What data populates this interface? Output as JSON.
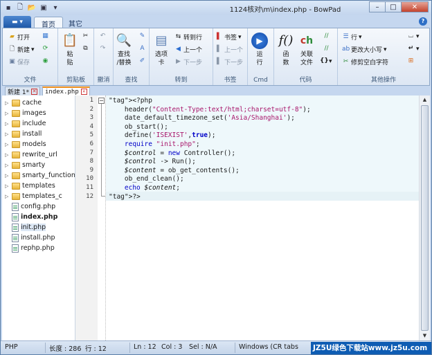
{
  "window": {
    "title": "1124核对\\m\\index.php - BowPad"
  },
  "ribbon_tabs": {
    "home": "首页",
    "other": "其它"
  },
  "groups": {
    "file": {
      "label": "文件",
      "open": "打开",
      "new": "新建",
      "save": "保存"
    },
    "clipboard": {
      "label": "剪贴板",
      "paste": "粘\n贴"
    },
    "undo": {
      "label": "撤消"
    },
    "find": {
      "label": "查找",
      "find_replace": "查找\n/替换"
    },
    "goto": {
      "label": "转到",
      "options": "选项\n卡",
      "goto_line": "转到行",
      "prev": "上一个",
      "next": "下一步"
    },
    "bookmarks": {
      "label": "书签",
      "bookmark": "书签",
      "prev": "上一个",
      "next": "下一步"
    },
    "cmd": {
      "label": "Cmd",
      "run": "运\n行"
    },
    "code": {
      "label": "代码",
      "functions": "函\n数",
      "related": "关联\n文件"
    },
    "other_ops": {
      "label": "其他操作",
      "line": "行",
      "case": "更改大小写",
      "trim": "修剪空白字符"
    }
  },
  "doc_tabs": [
    {
      "label": "新建 1*",
      "active": false
    },
    {
      "label": "index.php",
      "active": true
    }
  ],
  "tree": [
    {
      "name": "cache",
      "type": "folder"
    },
    {
      "name": "images",
      "type": "folder"
    },
    {
      "name": "include",
      "type": "folder"
    },
    {
      "name": "install",
      "type": "folder"
    },
    {
      "name": "models",
      "type": "folder"
    },
    {
      "name": "rewrite_url",
      "type": "folder"
    },
    {
      "name": "smarty",
      "type": "folder"
    },
    {
      "name": "smarty_function",
      "type": "folder"
    },
    {
      "name": "templates",
      "type": "folder"
    },
    {
      "name": "templates_c",
      "type": "folder"
    },
    {
      "name": "config.php",
      "type": "file"
    },
    {
      "name": "index.php",
      "type": "file",
      "bold": true
    },
    {
      "name": "init.php",
      "type": "file",
      "selected": true
    },
    {
      "name": "install.php",
      "type": "file"
    },
    {
      "name": "rephp.php",
      "type": "file"
    }
  ],
  "code_lines": [
    "<?php",
    "    header(\"Content-Type:text/html;charset=utf-8\");",
    "    date_default_timezone_set('Asia/Shanghai');",
    "    ob_start();",
    "    define('ISEXIST',true);",
    "    require \"init.php\";",
    "    $control = new Controller();",
    "    $control -> Run();",
    "    $content = ob_get_contents();",
    "    ob_end_clean();",
    "    echo $content;",
    "?>"
  ],
  "status": {
    "lang": "PHP",
    "length": "长度 : 286",
    "lines": "行 : 12",
    "ln": "Ln : 12",
    "col": "Col : 3",
    "sel": "Sel : N/A",
    "eol": "Windows (CR tabs"
  },
  "watermark": "JZ5U绿色下载站www.jz5u.com"
}
